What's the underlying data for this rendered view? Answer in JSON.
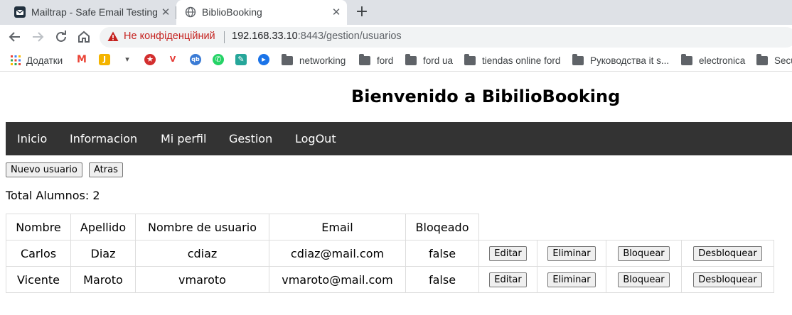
{
  "browser": {
    "tabs": [
      {
        "title": "Mailtrap - Safe Email Testing",
        "active": false
      },
      {
        "title": "BiblioBooking",
        "active": true
      }
    ],
    "new_tab": "+",
    "security_label": "Не конфіденційний",
    "url_host": "192.168.33.10",
    "url_rest": ":8443/gestion/usuarios",
    "bookmarks": [
      {
        "label": "Додатки",
        "icon": "apps-grid-icon"
      },
      {
        "label": "networking",
        "icon": "folder-icon"
      },
      {
        "label": "ford",
        "icon": "folder-icon"
      },
      {
        "label": "ford ua",
        "icon": "folder-icon"
      },
      {
        "label": "tiendas online ford",
        "icon": "folder-icon"
      },
      {
        "label": "Руководства it s...",
        "icon": "folder-icon"
      },
      {
        "label": "electronica",
        "icon": "folder-icon"
      },
      {
        "label": "Secu",
        "icon": "folder-icon"
      }
    ]
  },
  "page": {
    "title": "Bienvenido a BibilioBooking",
    "nav": [
      "Inicio",
      "Informacion",
      "Mi perfil",
      "Gestion",
      "LogOut"
    ],
    "buttons": {
      "new_user": "Nuevo usuario",
      "back": "Atras"
    },
    "total": "Total Alumnos: 2",
    "table": {
      "headers": [
        "Nombre",
        "Apellido",
        "Nombre de usuario",
        "Email",
        "Bloqeado"
      ],
      "row_actions": [
        "Editar",
        "Eliminar",
        "Bloquear",
        "Desbloquear"
      ],
      "rows": [
        {
          "nombre": "Carlos",
          "apellido": "Diaz",
          "usuario": "cdiaz",
          "email": "cdiaz@mail.com",
          "bloqueado": "false"
        },
        {
          "nombre": "Vicente",
          "apellido": "Maroto",
          "usuario": "vmaroto",
          "email": "vmaroto@mail.com",
          "bloqueado": "false"
        }
      ]
    }
  },
  "colors": {
    "navbar_bg": "#333333",
    "warning_red": "#c5221f",
    "tabstrip_bg": "#dee1e6"
  }
}
